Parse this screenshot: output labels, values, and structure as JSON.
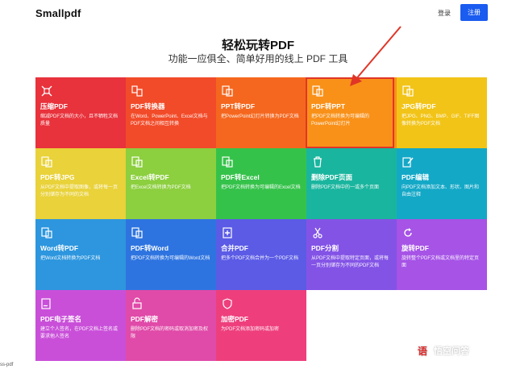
{
  "header": {
    "logo": "Smallpdf",
    "login": "登录",
    "register": "注册"
  },
  "hero": {
    "title": "轻松玩转PDF",
    "subtitle": "功能一应俱全、简单好用的线上 PDF 工具"
  },
  "tools": [
    {
      "title": "压缩PDF",
      "desc": "缩减PDF文档的大小，且不牺牲文档质量",
      "icon": "compress-icon",
      "color": "#e8323c"
    },
    {
      "title": "PDF转换器",
      "desc": "在Word、PowerPoint、Excel文档与PDF文档之间相互转换",
      "icon": "convert-icon",
      "color": "#f24b29"
    },
    {
      "title": "PPT转PDF",
      "desc": "把PowerPoint幻灯片转换为PDF文档",
      "icon": "ppt-icon",
      "color": "#f5671e"
    },
    {
      "title": "PDF转PPT",
      "desc": "把PDF文档转换为可编辑的PowerPoint幻灯片",
      "icon": "pdf-to-ppt-icon",
      "color": "#f99119"
    },
    {
      "title": "JPG转PDF",
      "desc": "把JPG、PNG、BMP、GIF、TIFF图像转换为PDF文档",
      "icon": "jpg-icon",
      "color": "#f2c418"
    },
    {
      "title": "PDF转JPG",
      "desc": "从PDF文档中提取图像，或将每一页分别储存为不同的文档",
      "icon": "pdf-to-jpg-icon",
      "color": "#e9d23a"
    },
    {
      "title": "Excel转PDF",
      "desc": "把Excel文档转换为PDF文档",
      "icon": "excel-icon",
      "color": "#8ccf3f"
    },
    {
      "title": "PDF转Excel",
      "desc": "把PDF文档转换为可编辑的Excel文档",
      "icon": "pdf-to-excel-icon",
      "color": "#35c24a"
    },
    {
      "title": "删除PDF页面",
      "desc": "删除PDF文档中的一或多个页面",
      "icon": "trash-icon",
      "color": "#1ab59e"
    },
    {
      "title": "PDF编辑",
      "desc": "向PDF文档添加文本、形状、图片和自由注释",
      "icon": "edit-icon",
      "color": "#14a8c7"
    },
    {
      "title": "Word转PDF",
      "desc": "把Word文档转换为PDF文档",
      "icon": "word-icon",
      "color": "#2d96de"
    },
    {
      "title": "PDF转Word",
      "desc": "把PDF文档转换为可编辑的Word文档",
      "icon": "pdf-to-word-icon",
      "color": "#2e74e0"
    },
    {
      "title": "合并PDF",
      "desc": "把多个PDF文档合并为一个PDF文档",
      "icon": "merge-icon",
      "color": "#5b5be6"
    },
    {
      "title": "PDF分割",
      "desc": "从PDF文档中提取特定页面，或将每一页分别储存为不同的PDF文档",
      "icon": "scissors-icon",
      "color": "#8353e6"
    },
    {
      "title": "旋转PDF",
      "desc": "旋转整个PDF文档或文档里的特定页面",
      "icon": "rotate-icon",
      "color": "#a653e6"
    },
    {
      "title": "PDF电子签名",
      "desc": "建立个人签名，在PDF文档上签名或要求他人签名",
      "icon": "sign-icon",
      "color": "#c94fd9"
    },
    {
      "title": "PDF解密",
      "desc": "删除PDF文档的密码或取消加密及权限",
      "icon": "unlock-icon",
      "color": "#e04aa8"
    },
    {
      "title": "加密PDF",
      "desc": "为PDF文档添加密码或加密",
      "icon": "shield-icon",
      "color": "#ee3f7c"
    }
  ],
  "footer": {
    "url_fragment": "ss-pdf"
  },
  "watermark": {
    "text": "悟空问答",
    "badge": "语"
  }
}
